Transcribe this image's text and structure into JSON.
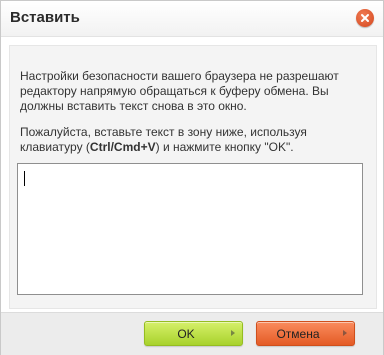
{
  "dialog": {
    "title": "Вставить",
    "close_icon": "close-icon"
  },
  "content": {
    "message": "Настройки безопасности вашего браузера не разрешают редактору напрямую обращаться к буферу обмена. Вы должны вставить текст снова в это окно.",
    "instruction_before": "Пожалуйста, вставьте текст в зону ниже, используя клавиатуру (",
    "instruction_shortcut": "Ctrl/Cmd+V",
    "instruction_after": ") и нажмите кнопку \"OK\".",
    "paste_value": ""
  },
  "footer": {
    "ok_label": "OK",
    "cancel_label": "Отмена"
  },
  "colors": {
    "ok_button": "#a8d22c",
    "cancel_button": "#e45b25",
    "close_button": "#d4461c"
  }
}
